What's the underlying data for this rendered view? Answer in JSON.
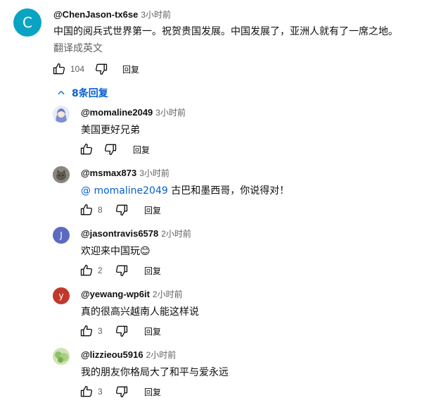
{
  "top_comment": {
    "avatar_letter": "C",
    "avatar_color": "#0aa4c2",
    "author": "@ChenJason-tx6se",
    "time": "3小时前",
    "text": "中国的阅兵式世界第一。祝贺贵国发展。中国发展了，亚洲人就有了一席之地。",
    "translate_label": "翻译成英文",
    "likes": "104",
    "reply_label": "回复"
  },
  "replies_toggle": {
    "label": "8条回复",
    "icon": "chevron-up-icon"
  },
  "replies": [
    {
      "author": "@momaline2049",
      "time": "3小时前",
      "text": "美国更好兄弟",
      "mention": "",
      "likes": "",
      "reply_label": "回复",
      "avatar_letter": "",
      "avatar_color": "#6f7fb8",
      "avatar_type": "anime"
    },
    {
      "author": "@msmax873",
      "time": "3小时前",
      "mention": "@ momaline2049",
      "text": " 古巴和墨西哥，你说得对！",
      "likes": "8",
      "reply_label": "回复",
      "avatar_letter": "",
      "avatar_color": "#7d7a74",
      "avatar_type": "cat-photo"
    },
    {
      "author": "@jasontravis6578",
      "time": "2小时前",
      "text": "欢迎来中国玩😊",
      "mention": "",
      "likes": "2",
      "reply_label": "回复",
      "avatar_letter": "J",
      "avatar_color": "#5c6bc0",
      "avatar_type": "letter"
    },
    {
      "author": "@yewang-wp6it",
      "time": "2小时前",
      "text": "真的很高兴越南人能这样说",
      "mention": "",
      "likes": "3",
      "reply_label": "回复",
      "avatar_letter": "y",
      "avatar_color": "#c0392b",
      "avatar_type": "letter"
    },
    {
      "author": "@lizzieou5916",
      "time": "2小时前",
      "text": "我的朋友你格局大了和平与爱永远",
      "mention": "",
      "likes": "3",
      "reply_label": "回复",
      "avatar_letter": "",
      "avatar_color": "#a9c98a",
      "avatar_type": "nature-photo"
    }
  ]
}
